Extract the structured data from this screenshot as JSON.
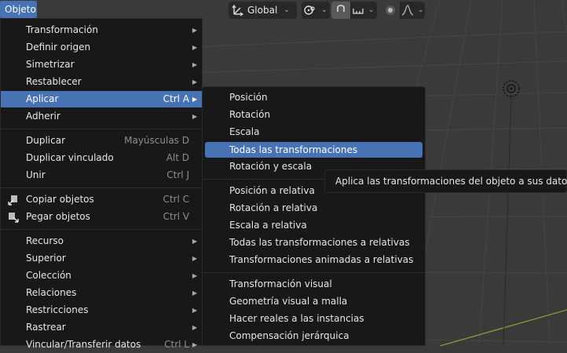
{
  "header": {
    "menu_title": "Objeto",
    "orientation_label": "Global",
    "icons": [
      "transform-orientation-icon",
      "chevron-down-icon",
      "pivot-icon",
      "snap-magnet-icon",
      "snap-increment-icon",
      "proportional-edit-icon",
      "falloff-curve-icon"
    ]
  },
  "menu": {
    "items": [
      {
        "label": "Transformación",
        "shortcut": "",
        "submenu": true
      },
      {
        "label": "Definir origen",
        "shortcut": "",
        "submenu": true
      },
      {
        "label": "Simetrizar",
        "shortcut": "",
        "submenu": true
      },
      {
        "label": "Restablecer",
        "shortcut": "",
        "submenu": true
      },
      {
        "label": "Aplicar",
        "shortcut": "Ctrl A",
        "submenu": true
      },
      {
        "label": "Adherir",
        "shortcut": "",
        "submenu": true
      },
      {
        "label": "Duplicar",
        "shortcut": "Mayúsculas D",
        "submenu": false
      },
      {
        "label": "Duplicar vinculado",
        "shortcut": "Alt D",
        "submenu": false
      },
      {
        "label": "Unir",
        "shortcut": "Ctrl J",
        "submenu": false
      },
      {
        "label": "Copiar objetos",
        "shortcut": "Ctrl C",
        "submenu": false,
        "icon": "copy-icon"
      },
      {
        "label": "Pegar objetos",
        "shortcut": "Ctrl V",
        "submenu": false,
        "icon": "paste-icon"
      },
      {
        "label": "Recurso",
        "shortcut": "",
        "submenu": true
      },
      {
        "label": "Superior",
        "shortcut": "",
        "submenu": true
      },
      {
        "label": "Colección",
        "shortcut": "",
        "submenu": true
      },
      {
        "label": "Relaciones",
        "shortcut": "",
        "submenu": true
      },
      {
        "label": "Restricciones",
        "shortcut": "",
        "submenu": true
      },
      {
        "label": "Rastrear",
        "shortcut": "",
        "submenu": true
      },
      {
        "label": "Vincular/Transferir datos",
        "shortcut": "Ctrl L",
        "submenu": true
      }
    ]
  },
  "submenu": {
    "items": [
      "Posición",
      "Rotación",
      "Escala",
      "Todas las transformaciones",
      "Rotación y escala",
      "Posición a relativa",
      "Rotación a relativa",
      "Escala a relativa",
      "Todas las transformaciones a relativas",
      "Transformaciones animadas a relativas",
      "Transformación visual",
      "Geometría visual a malla",
      "Hacer reales a las instancias",
      "Compensación jerárquica"
    ]
  },
  "tooltip": {
    "text": "Aplica las transformaciones del objeto a sus datos."
  },
  "colors": {
    "accent": "#4772b3",
    "menu_bg": "#181818",
    "viewport_bg": "#3a3a3a",
    "grid_line": "#444444",
    "axis_y": "#7fa03a"
  }
}
